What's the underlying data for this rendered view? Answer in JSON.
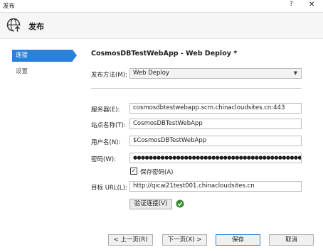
{
  "window": {
    "title": "发布",
    "help_glyph": "?",
    "close_glyph": "✕"
  },
  "header": {
    "title": "发布",
    "icon": "globe-upload-icon"
  },
  "sidebar": {
    "items": [
      {
        "label": "连接",
        "active": true
      },
      {
        "label": "设置",
        "active": false
      }
    ]
  },
  "main": {
    "profile_title": "CosmosDBTestWebApp - Web Deploy *",
    "publish_method": {
      "label": "发布方法(M):",
      "value": "Web Deploy"
    },
    "server": {
      "label": "服务器(E):",
      "value": "cosmosdbtestwebapp.scm.chinacloudsites.cn:443"
    },
    "site_name": {
      "label": "站点名称(T):",
      "value": "CosmosDBTestWebApp"
    },
    "username": {
      "label": "用户名(N):",
      "value": "$CosmosDBTestWebApp"
    },
    "password": {
      "label": "密码(W):",
      "value": "●●●●●●●●●●●●●●●●●●●●●●●●●●●●●●●●●●●●●●●●●●●●●●●●●●●●●●●"
    },
    "save_password": {
      "label": "保存密码(A)",
      "checked": true,
      "glyph": "✓"
    },
    "destination_url": {
      "label": "目标 URL(L):",
      "value": "http://qicai21test001.chinacloudsites.cn"
    },
    "validate_button": {
      "label": "验证连接(V)"
    },
    "validation_status": {
      "icon": "check-circle-icon",
      "color": "#388a34"
    }
  },
  "footer": {
    "prev": "< 上一页(R)",
    "next": "下一页(X) >",
    "save": "保存",
    "cancel": "取消"
  },
  "colors": {
    "accent": "#2a82d8"
  }
}
